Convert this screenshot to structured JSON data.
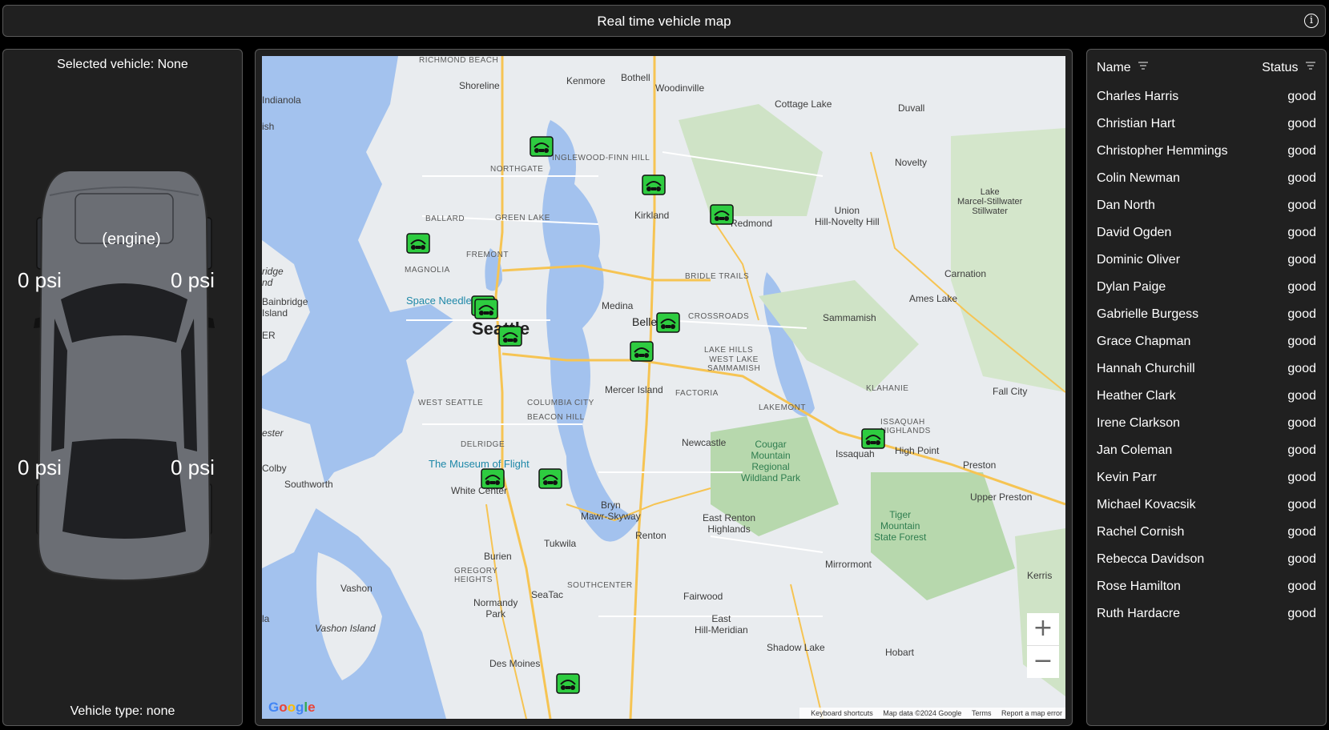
{
  "header": {
    "title": "Real time vehicle map",
    "info_icon": "info-icon"
  },
  "vehicle_panel": {
    "selected": "Selected vehicle: None",
    "engine_label": "(engine)",
    "tires": {
      "front_left": "0 psi",
      "front_right": "0 psi",
      "rear_left": "0 psi",
      "rear_right": "0 psi"
    },
    "vehicle_type": "Vehicle type: none"
  },
  "map": {
    "labels": {
      "richmond": "RICHMOND BEACH",
      "shoreline": "Shoreline",
      "kenmore": "Kenmore",
      "bothell": "Bothell",
      "woodinville": "Woodinville",
      "cottage_lake": "Cottage Lake",
      "duvall": "Duvall",
      "indianola": "Indianola",
      "novelty": "Novelty",
      "inglewood": "INGLEWOOD-FINN HILL",
      "northgate": "NORTHGATE",
      "lake_marcel": "Lake\nMarcel-Stillwater\nStillwater",
      "kirkland": "Kirkland",
      "union_hill": "Union\nHill-Novelty Hill",
      "ballard": "BALLARD",
      "green_lake": "GREEN LAKE",
      "redmond": "Redmond",
      "fremont": "FREMONT",
      "magnolia": "MAGNOLIA",
      "carnation": "Carnation",
      "bridle_trails": "BRIDLE TRAILS",
      "ames_lake": "Ames Lake",
      "bainbridge": "Bainbridge\nIsland",
      "space_needle": "Space Needle",
      "medina": "Medina",
      "sammamish": "Sammamish",
      "crossroads": "CROSSROADS",
      "seattle": "Seattle",
      "bellevue": "Bellevue",
      "lake_hills": "LAKE HILLS",
      "west_lake_sammamish": "WEST LAKE\nSAMMAMISH",
      "mercer_island": "Mercer Island",
      "factoria": "FACTORIA",
      "klahanie": "KLAHANIE",
      "fall_city": "Fall City",
      "west_seattle": "WEST SEATTLE",
      "columbia_city": "COLUMBIA CITY",
      "lakemont": "LAKEMONT",
      "beacon_hill": "BEACON HILL",
      "issaquah_highlands": "ISSAQUAH\nHIGHLANDS",
      "delridge": "DELRIDGE",
      "newcastle": "Newcastle",
      "cougar_mountain": "Cougar\nMountain\nRegional\nWildland Park",
      "issaquah": "Issaquah",
      "high_point": "High Point",
      "preston": "Preston",
      "museum_of_flight": "The Museum of Flight",
      "colby": "Colby",
      "southworth": "Southworth",
      "upper_preston": "Upper Preston",
      "white_center": "White Center",
      "bryn_mawr": "Bryn\nMawr-Skyway",
      "tiger_mountain": "Tiger\nMountain\nState Forest",
      "east_renton": "East Renton\nHighlands",
      "renton": "Renton",
      "tukwila": "Tukwila",
      "burien": "Burien",
      "mirrormont": "Mirrormont",
      "gregory_heights": "GREGORY\nHEIGHTS",
      "vashon": "Vashon",
      "seatac": "SeaTac",
      "southcenter": "SOUTHCENTER",
      "fairwood": "Fairwood",
      "normandy_park": "Normandy\nPark",
      "vashon_island": "Vashon Island",
      "east_hill": "East\nHill-Meridian",
      "shadow_lake": "Shadow Lake",
      "hobart": "Hobart",
      "des_moines": "Des Moines",
      "kerris": "Kerris",
      "ester": "ester",
      "idge": "ridge\nnd",
      "ish": "ish",
      "er": "ER",
      "la": "la"
    },
    "zoom_in": "+",
    "zoom_out": "−",
    "google": "Google",
    "attribution": {
      "keyboard": "Keyboard shortcuts",
      "data": "Map data ©2024 Google",
      "terms": "Terms",
      "report": "Report a map error"
    }
  },
  "driver_table": {
    "headers": {
      "name": "Name",
      "status": "Status"
    },
    "rows": [
      {
        "name": "Charles Harris",
        "status": "good"
      },
      {
        "name": "Christian Hart",
        "status": "good"
      },
      {
        "name": "Christopher Hemmings",
        "status": "good"
      },
      {
        "name": "Colin Newman",
        "status": "good"
      },
      {
        "name": "Dan North",
        "status": "good"
      },
      {
        "name": "David Ogden",
        "status": "good"
      },
      {
        "name": "Dominic Oliver",
        "status": "good"
      },
      {
        "name": "Dylan Paige",
        "status": "good"
      },
      {
        "name": "Gabrielle Burgess",
        "status": "good"
      },
      {
        "name": "Grace Chapman",
        "status": "good"
      },
      {
        "name": "Hannah Churchill",
        "status": "good"
      },
      {
        "name": "Heather Clark",
        "status": "good"
      },
      {
        "name": "Irene Clarkson",
        "status": "good"
      },
      {
        "name": "Jan Coleman",
        "status": "good"
      },
      {
        "name": "Kevin Parr",
        "status": "good"
      },
      {
        "name": "Michael Kovacsik",
        "status": "good"
      },
      {
        "name": "Rachel Cornish",
        "status": "good"
      },
      {
        "name": "Rebecca Davidson",
        "status": "good"
      },
      {
        "name": "Rose Hamilton",
        "status": "good"
      },
      {
        "name": "Ruth Hardacre",
        "status": "good"
      }
    ]
  },
  "colors": {
    "accent": "#2ecc40",
    "panel": "#202020",
    "water": "#a3c2ee",
    "land": "#e9ecef"
  }
}
